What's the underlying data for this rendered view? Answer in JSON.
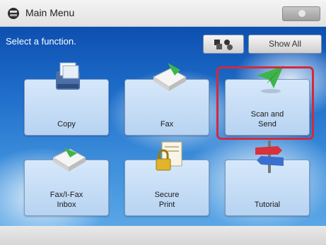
{
  "header": {
    "title": "Main Menu"
  },
  "subtitle": "Select a function.",
  "toolbar": {
    "show_all_label": "Show All"
  },
  "tiles": [
    {
      "label": "Copy",
      "icon": "copy-icon"
    },
    {
      "label": "Fax",
      "icon": "fax-icon"
    },
    {
      "label": "Scan and\nSend",
      "icon": "scan-send-icon",
      "selected": true
    },
    {
      "label": "Fax/I-Fax\nInbox",
      "icon": "inbox-icon"
    },
    {
      "label": "Secure\nPrint",
      "icon": "secure-print-icon"
    },
    {
      "label": "Tutorial",
      "icon": "tutorial-icon"
    }
  ],
  "colors": {
    "selection": "#d32a3a",
    "sky_top": "#0d4fb0",
    "tile": "#c9def6"
  }
}
